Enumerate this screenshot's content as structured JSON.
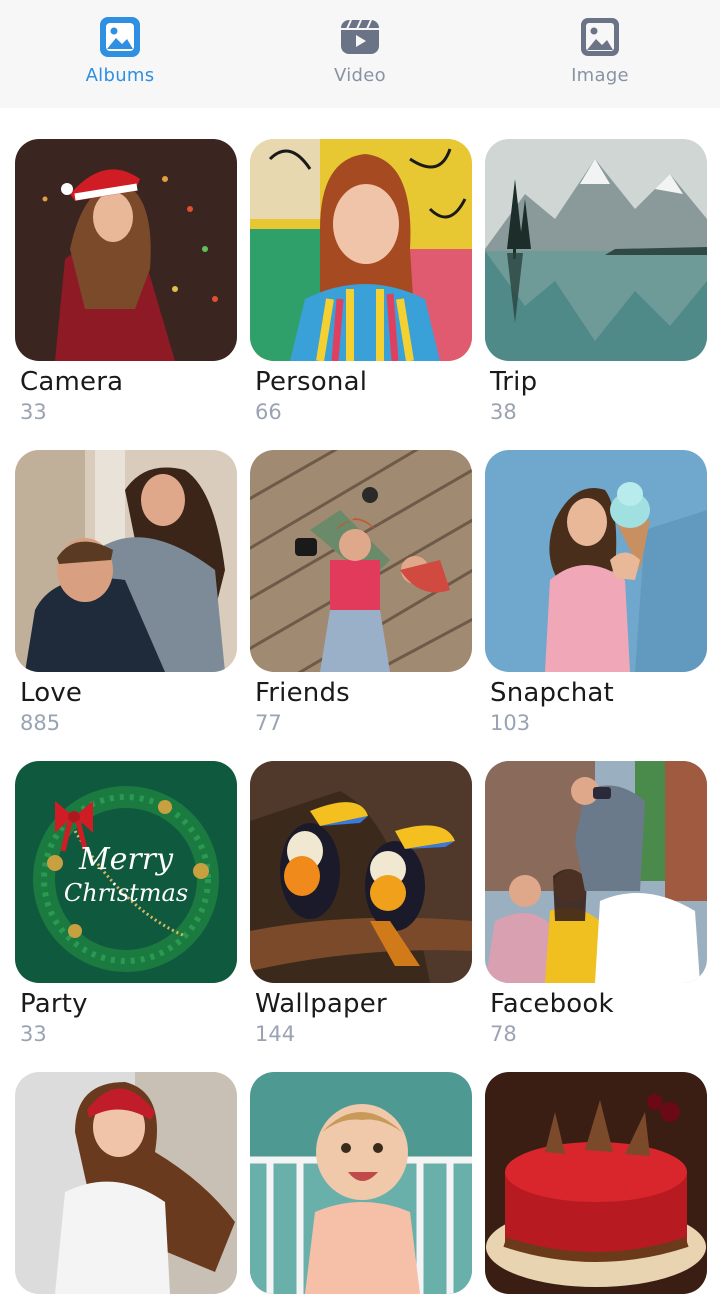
{
  "tabs": [
    {
      "label": "Albums",
      "icon": "albums-icon",
      "active": true
    },
    {
      "label": "Video",
      "icon": "video-icon",
      "active": false
    },
    {
      "label": "Image",
      "icon": "image-icon",
      "active": false
    }
  ],
  "colors": {
    "accent": "#2f8fe0",
    "inactive": "#8a93a3",
    "tabbar_bg": "#f7f7f8",
    "count_text": "#9aa3b2"
  },
  "albums": [
    {
      "name": "Camera",
      "count": "33"
    },
    {
      "name": "Personal",
      "count": "66"
    },
    {
      "name": "Trip",
      "count": "38"
    },
    {
      "name": "Love",
      "count": "885"
    },
    {
      "name": "Friends",
      "count": "77"
    },
    {
      "name": "Snapchat",
      "count": "103"
    },
    {
      "name": "Party",
      "count": "33"
    },
    {
      "name": "Wallpaper",
      "count": "144"
    },
    {
      "name": "Facebook",
      "count": "78"
    },
    {
      "name": "",
      "count": ""
    },
    {
      "name": "",
      "count": ""
    },
    {
      "name": "",
      "count": ""
    }
  ],
  "thumbnail_text": {
    "party_greeting_line1": "Merry",
    "party_greeting_line2": "Christmas"
  }
}
